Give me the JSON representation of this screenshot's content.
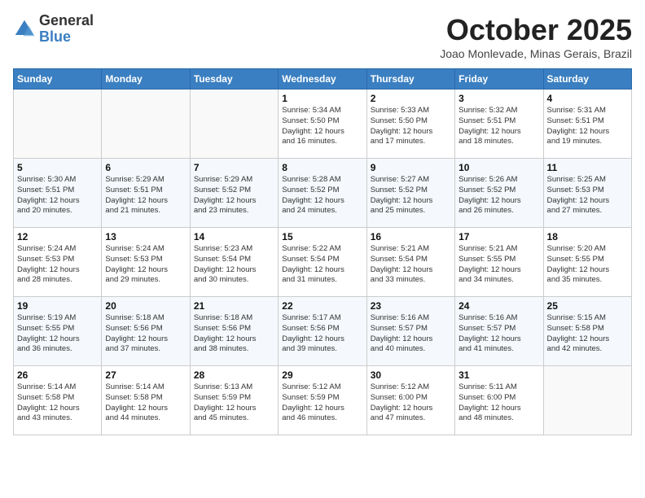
{
  "header": {
    "logo_line1": "General",
    "logo_line2": "Blue",
    "month": "October 2025",
    "location": "Joao Monlevade, Minas Gerais, Brazil"
  },
  "weekdays": [
    "Sunday",
    "Monday",
    "Tuesday",
    "Wednesday",
    "Thursday",
    "Friday",
    "Saturday"
  ],
  "weeks": [
    [
      {
        "day": "",
        "info": ""
      },
      {
        "day": "",
        "info": ""
      },
      {
        "day": "",
        "info": ""
      },
      {
        "day": "1",
        "info": "Sunrise: 5:34 AM\nSunset: 5:50 PM\nDaylight: 12 hours\nand 16 minutes."
      },
      {
        "day": "2",
        "info": "Sunrise: 5:33 AM\nSunset: 5:50 PM\nDaylight: 12 hours\nand 17 minutes."
      },
      {
        "day": "3",
        "info": "Sunrise: 5:32 AM\nSunset: 5:51 PM\nDaylight: 12 hours\nand 18 minutes."
      },
      {
        "day": "4",
        "info": "Sunrise: 5:31 AM\nSunset: 5:51 PM\nDaylight: 12 hours\nand 19 minutes."
      }
    ],
    [
      {
        "day": "5",
        "info": "Sunrise: 5:30 AM\nSunset: 5:51 PM\nDaylight: 12 hours\nand 20 minutes."
      },
      {
        "day": "6",
        "info": "Sunrise: 5:29 AM\nSunset: 5:51 PM\nDaylight: 12 hours\nand 21 minutes."
      },
      {
        "day": "7",
        "info": "Sunrise: 5:29 AM\nSunset: 5:52 PM\nDaylight: 12 hours\nand 23 minutes."
      },
      {
        "day": "8",
        "info": "Sunrise: 5:28 AM\nSunset: 5:52 PM\nDaylight: 12 hours\nand 24 minutes."
      },
      {
        "day": "9",
        "info": "Sunrise: 5:27 AM\nSunset: 5:52 PM\nDaylight: 12 hours\nand 25 minutes."
      },
      {
        "day": "10",
        "info": "Sunrise: 5:26 AM\nSunset: 5:52 PM\nDaylight: 12 hours\nand 26 minutes."
      },
      {
        "day": "11",
        "info": "Sunrise: 5:25 AM\nSunset: 5:53 PM\nDaylight: 12 hours\nand 27 minutes."
      }
    ],
    [
      {
        "day": "12",
        "info": "Sunrise: 5:24 AM\nSunset: 5:53 PM\nDaylight: 12 hours\nand 28 minutes."
      },
      {
        "day": "13",
        "info": "Sunrise: 5:24 AM\nSunset: 5:53 PM\nDaylight: 12 hours\nand 29 minutes."
      },
      {
        "day": "14",
        "info": "Sunrise: 5:23 AM\nSunset: 5:54 PM\nDaylight: 12 hours\nand 30 minutes."
      },
      {
        "day": "15",
        "info": "Sunrise: 5:22 AM\nSunset: 5:54 PM\nDaylight: 12 hours\nand 31 minutes."
      },
      {
        "day": "16",
        "info": "Sunrise: 5:21 AM\nSunset: 5:54 PM\nDaylight: 12 hours\nand 33 minutes."
      },
      {
        "day": "17",
        "info": "Sunrise: 5:21 AM\nSunset: 5:55 PM\nDaylight: 12 hours\nand 34 minutes."
      },
      {
        "day": "18",
        "info": "Sunrise: 5:20 AM\nSunset: 5:55 PM\nDaylight: 12 hours\nand 35 minutes."
      }
    ],
    [
      {
        "day": "19",
        "info": "Sunrise: 5:19 AM\nSunset: 5:55 PM\nDaylight: 12 hours\nand 36 minutes."
      },
      {
        "day": "20",
        "info": "Sunrise: 5:18 AM\nSunset: 5:56 PM\nDaylight: 12 hours\nand 37 minutes."
      },
      {
        "day": "21",
        "info": "Sunrise: 5:18 AM\nSunset: 5:56 PM\nDaylight: 12 hours\nand 38 minutes."
      },
      {
        "day": "22",
        "info": "Sunrise: 5:17 AM\nSunset: 5:56 PM\nDaylight: 12 hours\nand 39 minutes."
      },
      {
        "day": "23",
        "info": "Sunrise: 5:16 AM\nSunset: 5:57 PM\nDaylight: 12 hours\nand 40 minutes."
      },
      {
        "day": "24",
        "info": "Sunrise: 5:16 AM\nSunset: 5:57 PM\nDaylight: 12 hours\nand 41 minutes."
      },
      {
        "day": "25",
        "info": "Sunrise: 5:15 AM\nSunset: 5:58 PM\nDaylight: 12 hours\nand 42 minutes."
      }
    ],
    [
      {
        "day": "26",
        "info": "Sunrise: 5:14 AM\nSunset: 5:58 PM\nDaylight: 12 hours\nand 43 minutes."
      },
      {
        "day": "27",
        "info": "Sunrise: 5:14 AM\nSunset: 5:58 PM\nDaylight: 12 hours\nand 44 minutes."
      },
      {
        "day": "28",
        "info": "Sunrise: 5:13 AM\nSunset: 5:59 PM\nDaylight: 12 hours\nand 45 minutes."
      },
      {
        "day": "29",
        "info": "Sunrise: 5:12 AM\nSunset: 5:59 PM\nDaylight: 12 hours\nand 46 minutes."
      },
      {
        "day": "30",
        "info": "Sunrise: 5:12 AM\nSunset: 6:00 PM\nDaylight: 12 hours\nand 47 minutes."
      },
      {
        "day": "31",
        "info": "Sunrise: 5:11 AM\nSunset: 6:00 PM\nDaylight: 12 hours\nand 48 minutes."
      },
      {
        "day": "",
        "info": ""
      }
    ]
  ]
}
